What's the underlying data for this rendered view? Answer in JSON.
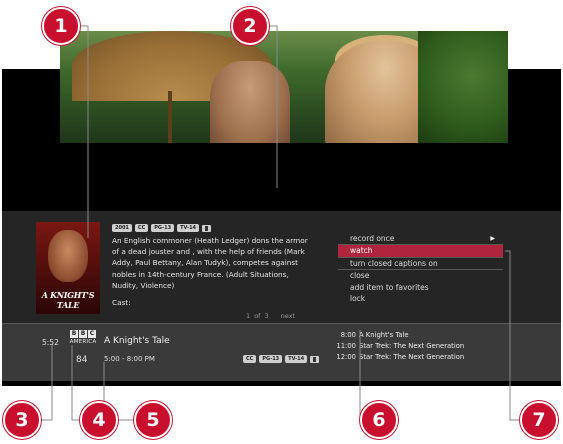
{
  "program": {
    "badges": [
      "2001",
      "CC",
      "PG-13",
      "TV-14"
    ],
    "synopsis": "An English commoner (Heath Ledger) dons the armor of a dead jouster and , with the help of friends (Mark Addy, Paul Bettany, Alan Tudyk), competes against nobles in 14th-century France. (Adult Situations, Nudity, Violence)",
    "cast_label": "Cast:",
    "poster_title": "A KNIGHT'S TALE",
    "pager": {
      "position": "1 of 3",
      "next": "next"
    }
  },
  "menu": {
    "items": [
      "record once",
      "watch",
      "turn closed captions on",
      "close",
      "add item to favorites",
      "lock"
    ],
    "selected": "watch"
  },
  "now_playing": {
    "clock": "5:52",
    "channel_logo": [
      "B",
      "B",
      "C"
    ],
    "channel_logo_sub": "AMERICA",
    "channel_number": "84",
    "title": "A Knight's Tale",
    "time_range": "5:00 - 8:00 PM",
    "badges": [
      "CC",
      "PG-13",
      "TV-14"
    ]
  },
  "schedule": [
    {
      "time": "8:00",
      "title": "A Knight's Tale"
    },
    {
      "time": "11:00",
      "title": "Star Trek: The Next Generation"
    },
    {
      "time": "12:00",
      "title": "Star Trek: The Next Generation"
    }
  ],
  "callouts": [
    "1",
    "2",
    "3",
    "4",
    "5",
    "6",
    "7"
  ],
  "colors": {
    "accent": "#b0243d",
    "callout": "#c8102e",
    "panel": "#2a2a2a"
  },
  "icons": [
    "play-arrow-icon",
    "audio-description-icon"
  ]
}
